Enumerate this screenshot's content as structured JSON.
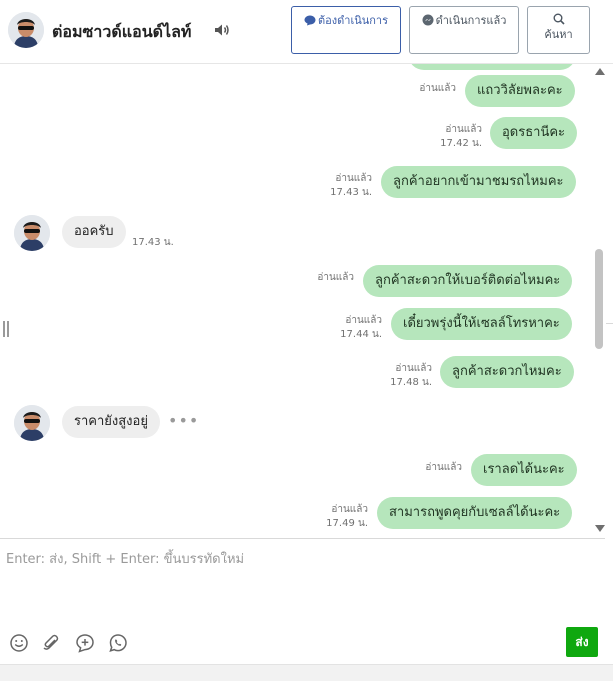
{
  "header": {
    "contact_name": "ต่อมซาวด์แอนด์ไลท์",
    "buttons": {
      "todo_label": "ต้องดำเนินการ",
      "done_label": "ดำเนินการแล้ว",
      "search_label": "ค้นหา"
    }
  },
  "messages": [
    {
      "direction": "out",
      "text": "แถววิลัยพละคะ",
      "status": "อ่านแล้ว",
      "time": ""
    },
    {
      "direction": "out",
      "text": "อุดรธานีคะ",
      "status": "อ่านแล้ว",
      "time": "17.42 น."
    },
    {
      "direction": "out",
      "text": "ลูกค้าอยากเข้ามาชมรถไหมคะ",
      "status": "อ่านแล้ว",
      "time": "17.43 น."
    },
    {
      "direction": "in",
      "text": "ออครับ",
      "time": "17.43 น."
    },
    {
      "direction": "out",
      "text": "ลูกค้าสะดวกให้เบอร์ติดต่อไหมคะ",
      "status": "อ่านแล้ว",
      "time": ""
    },
    {
      "direction": "out",
      "text": "เดี๋ยวพรุ่งนี้ให้เซลล์โทรหาคะ",
      "status": "อ่านแล้ว",
      "time": "17.44 น."
    },
    {
      "direction": "out",
      "text": "ลูกค้าสะดวกไหมคะ",
      "status": "อ่านแล้ว",
      "time": "17.48 น."
    },
    {
      "direction": "in",
      "text": "ราคายังสูงอยู่",
      "time": "",
      "typing": "•••"
    },
    {
      "direction": "out",
      "text": "เราลดได้นะคะ",
      "status": "อ่านแล้ว",
      "time": ""
    },
    {
      "direction": "out",
      "text": "สามารถพูดคุยกับเซลล์ได้นะคะ",
      "status": "อ่านแล้ว",
      "time": "17.49 น."
    }
  ],
  "composer": {
    "placeholder": "Enter: ส่ง, Shift + Enter: ขึ้นบรรทัดใหม่",
    "value": "",
    "send_label": "ส่ง",
    "tools": [
      "emoji-icon",
      "attach-icon",
      "add-circle-icon",
      "whatsapp-icon"
    ]
  },
  "colors": {
    "outgoing_bubble": "#b6e6bc",
    "incoming_bubble": "#eeeeee",
    "send_button": "#0fa80f",
    "primary_blue": "#3b5ea8"
  }
}
